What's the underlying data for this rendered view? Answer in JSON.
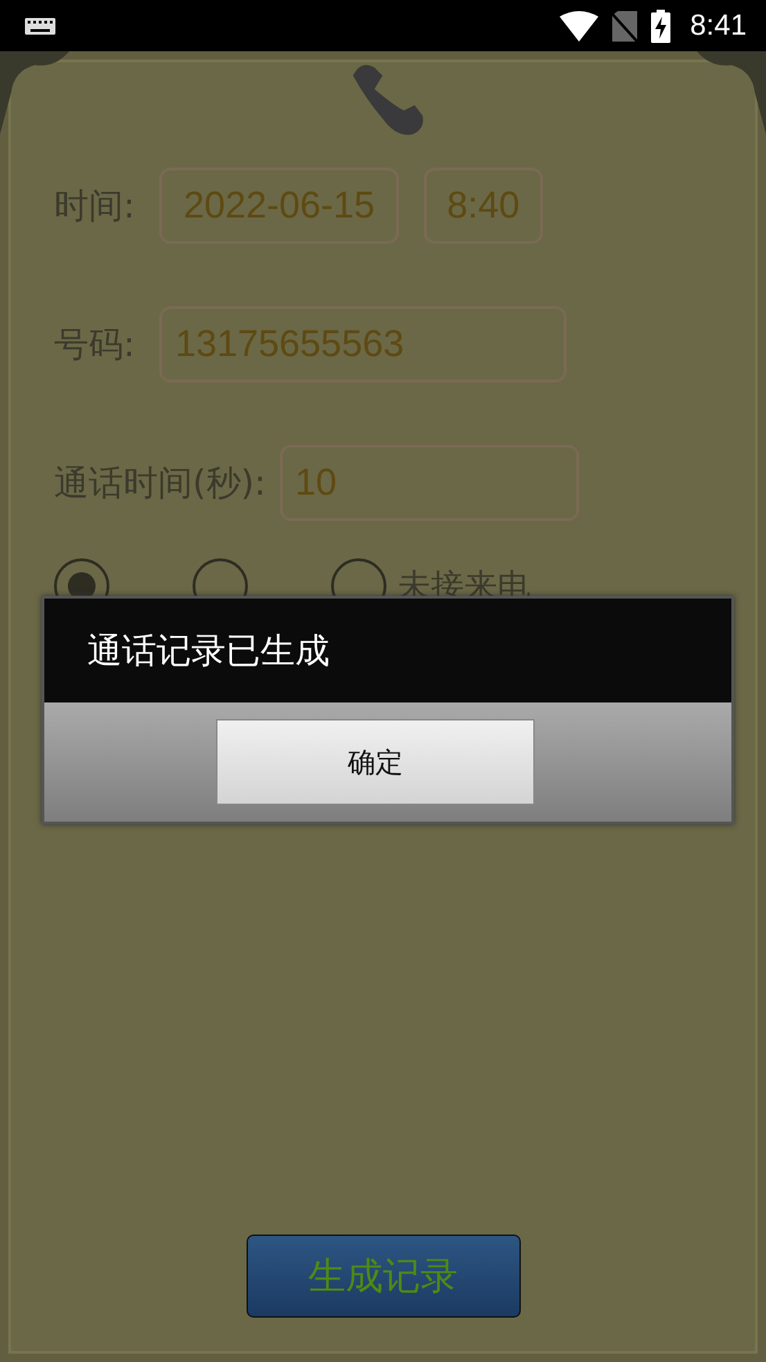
{
  "status_bar": {
    "time": "8:41"
  },
  "form": {
    "time_label": "时间:",
    "date": "2022-06-15",
    "clock": "8:40",
    "number_label": "号码:",
    "number": "13175655563",
    "duration_label": "通话时间(秒):",
    "duration": "10"
  },
  "call_types": [
    {
      "selected": true
    },
    {
      "selected": false
    },
    {
      "label": "未接来电",
      "selected": false
    }
  ],
  "dialog": {
    "message": "通话记录已生成",
    "button": "确定"
  },
  "generate_button": "生成记录"
}
